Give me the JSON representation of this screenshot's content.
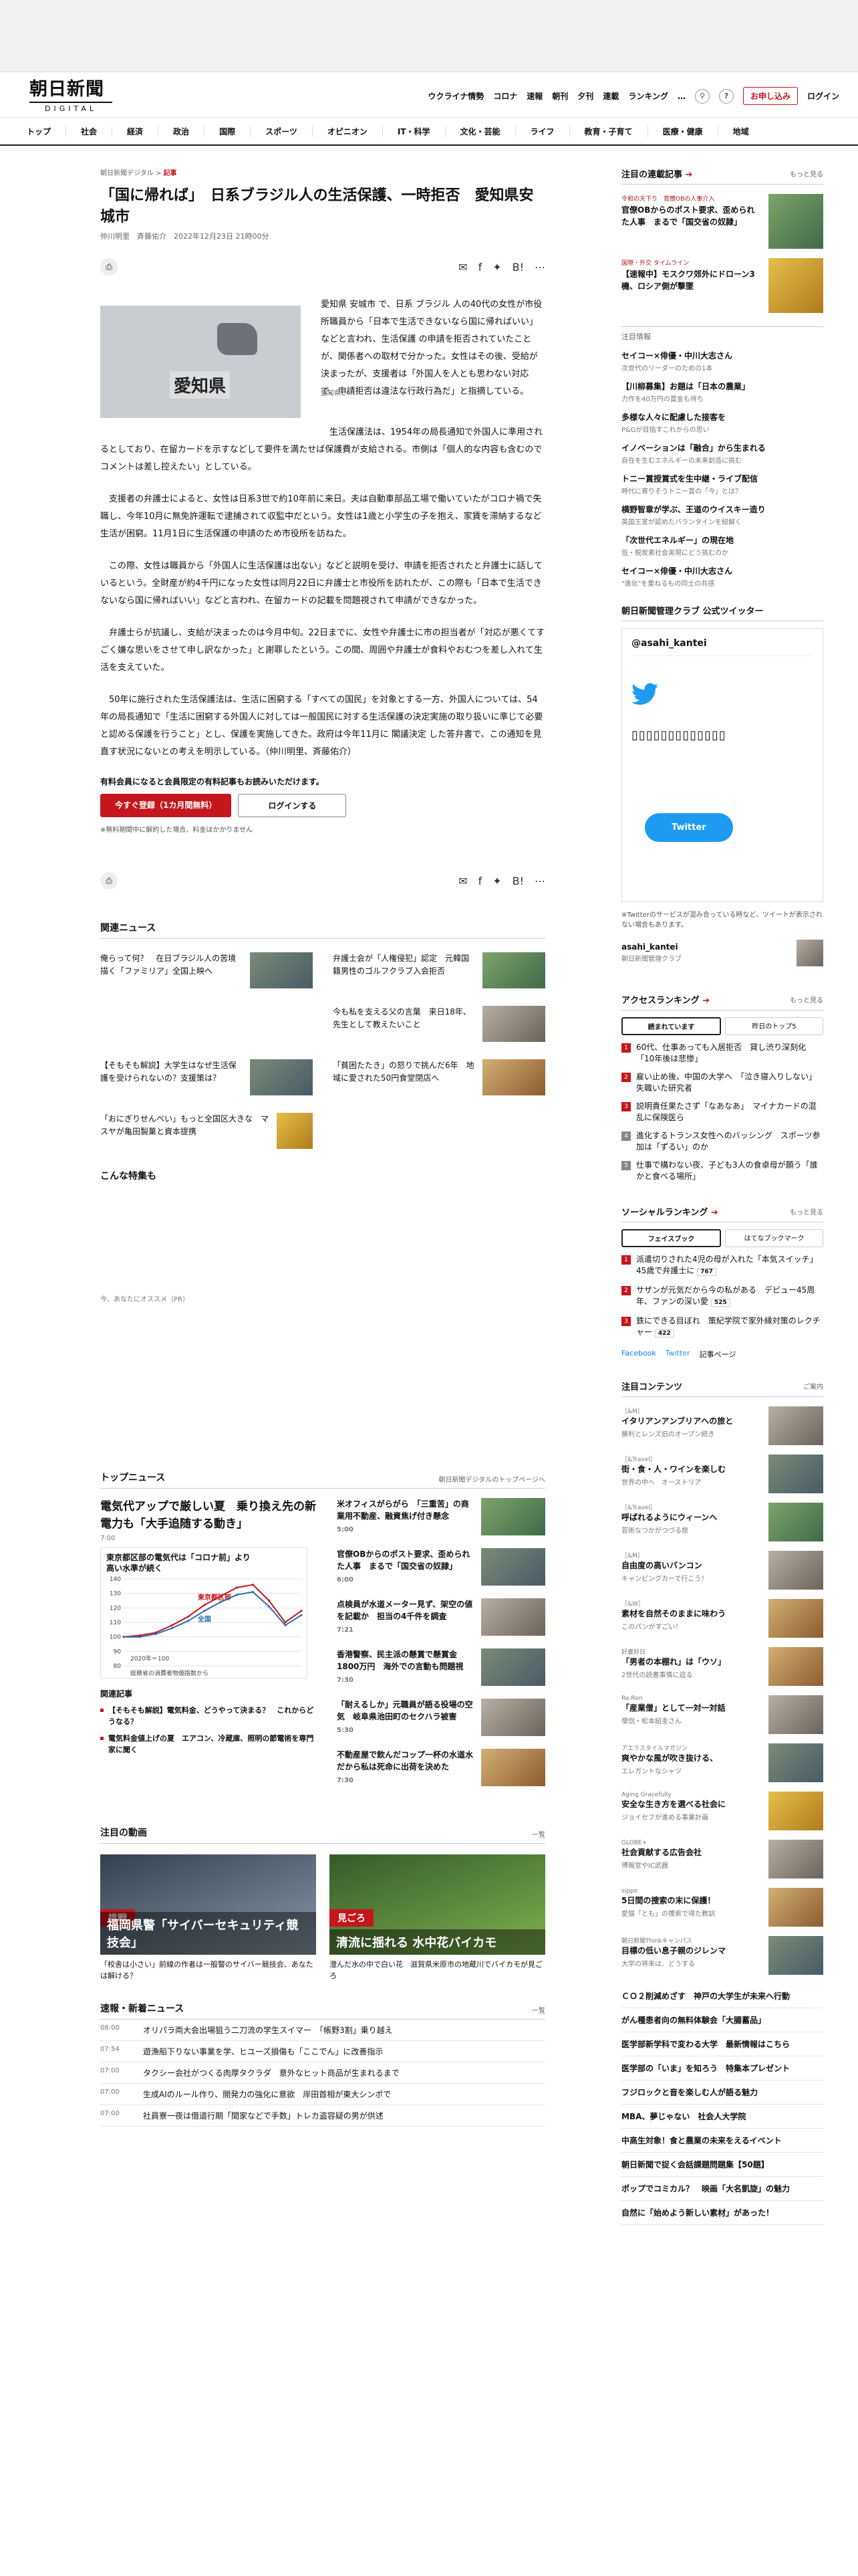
{
  "header": {
    "logo_jp": "朝日新聞",
    "logo_en": "DIGITAL",
    "nav": [
      "ウクライナ情勢",
      "コロナ",
      "速報",
      "朝刊",
      "夕刊",
      "連載",
      "ランキング"
    ],
    "more": "…",
    "signup": "お申し込み",
    "login": "ログイン"
  },
  "gnav": [
    "トップ",
    "社会",
    "経済",
    "政治",
    "国際",
    "スポーツ",
    "オピニオン",
    "IT・科学",
    "文化・芸能",
    "ライフ",
    "教育・子育て",
    "医療・健康",
    "地域"
  ],
  "article": {
    "crumb_home": "朝日新聞デジタル",
    "crumb_current": "記事",
    "title": "「国に帰れば」　日系ブラジル人の生活保護、一時拒否　愛知県安城市",
    "byline": "仲川明里　斉藤佑介　2022年12月23日 21時00分",
    "map_label": "愛知県",
    "map_caption": "愛知県",
    "lead": "愛知県 安城市 で、日系 ブラジル 人の40代の女性が市役所職員から「日本で生活できないなら国に帰ればいい」などと言われ、生活保護 の申請を拒否されていたことが、関係者への取材で分かった。女性はその後、受給が決まったが、支援者は「外国人を人とも思わない対応で、申請拒否は違法な行政行為だ」と指摘している。",
    "paragraphs": [
      "生活保護法は、1954年の局長通知で外国人に準用されるとしており、在留カードを示すなどして要件を満たせば保護費が支給される。市側は「個人的な内容も含むのでコメントは差し控えたい」としている。",
      "支援者の弁護士によると、女性は日系3世で約10年前に来日。夫は自動車部品工場で働いていたがコロナ禍で失職し、今年10月に無免許運転で逮捕されて収監中だという。女性は1歳と小学生の子を抱え、家賃を滞納するなど生活が困窮。11月1日に生活保護の申請のため市役所を訪ねた。",
      "この際、女性は職員から「外国人に生活保護は出ない」などと説明を受け、申請を拒否されたと弁護士に話しているという。全財産が約4千円になった女性は同月22日に弁護士と市役所を訪れたが、この際も「日本で生活できないなら国に帰ればいい」などと言われ、在留カードの記載を問題視されて申請ができなかった。",
      "弁護士らが抗議し、支給が決まったのは今月中旬。22日までに、女性や弁護士に市の担当者が「対応が悪くてすごく嫌な思いをさせて申し訳なかった」と謝罪したという。この間、周囲や弁護士が食料やおむつを差し入れて生活を支えていた。",
      "50年に施行された生活保護法は、生活に困窮する「すべての国民」を対象とする一方、外国人については、54年の局長通知で「生活に困窮する外国人に対しては一般国民に対する生活保護の決定実施の取り扱いに準じて必要と認める保護を行うこと」とし、保護を実施してきた。政府は今年11月に 閣議決定 した答弁書で、この通知を見直す状況にないとの考えを明示している。（仲川明里、斉藤佑介）"
    ],
    "share_count1": "list",
    "share_count2": "0"
  },
  "cta": {
    "title": "有料会員になると会員限定の有料記事もお読みいただけます。",
    "primary": "今すぐ登録（1カ月間無料）",
    "secondary": "ログインする",
    "note": "※無料期間中に解約した場合、料金はかかりません"
  },
  "related": {
    "heading": "関連ニュース",
    "items": [
      "俺らって何？　在日ブラジル人の苦境描く「ファミリア」全国上映へ",
      "弁護士会が「人権侵犯」認定　元韓国籍男性のゴルフクラブ入会拒否",
      "",
      "今も私を支える父の言葉　来日18年、先生として教えたいこと",
      "【そもそも解説】大学生はなぜ生活保護を受けられないの？支援策は？",
      "「貧困たたき」の怒りで挑んだ6年　地域に愛された50円食堂閉店へ",
      "「おにぎりせんべい」もっと全国区大きな　マスヤが亀田製菓と資本提携",
      ""
    ]
  },
  "feature": {
    "heading": "こんな特集も",
    "pr": "今、あなたにオススメ（PR）"
  },
  "topnews": {
    "heading": "トップニュース",
    "link": "朝日新聞デジタルのトップページへ",
    "main_title": "電気代アップで厳しい夏　乗り換え先の新電力も「大手追随する動き」",
    "main_time": "7:00",
    "chart_title": "東京都区部の電気代は「コロナ前」より高い水準が続く",
    "related_heading": "関連記事",
    "related": [
      "【そもそも解説】電気料金、どうやって決まる？　これからどうなる？",
      "電気料金値上げの夏　エアコン、冷蔵庫、照明の節電術を専門家に聞く"
    ],
    "items": [
      {
        "title": "米オフィスがらがら　「三重苦」の商業用不動産、融資焦げ付き懸念",
        "time": "5:00"
      },
      {
        "title": "官僚OBからのポスト要求、歪められた人事　まるで「国交省の奴隷」",
        "time": "6:00"
      },
      {
        "title": "点検員が水道メーター見ず、架空の値を記載か　担当の4千件を調査",
        "time": "7:21"
      },
      {
        "title": "香港警察、民主派の懸賞で懸賞金1800万円　海外での言動も問題視",
        "time": "7:30"
      },
      {
        "title": "「耐えるしか」元職員が語る役場の空気　岐阜県池田町のセクハラ被害",
        "time": "5:30"
      },
      {
        "title": "不動産屋で飲んだコップ一杯の水道水　だから私は死命に出荷を決めた",
        "time": "7:30"
      }
    ]
  },
  "chart_data": {
    "type": "line",
    "title": "東京都区部の電気代は「コロナ前」より高い水準が続く",
    "annotation": "2020年＝100",
    "series": [
      {
        "name": "東京都区部",
        "values": [
          100,
          101,
          103,
          108,
          114,
          122,
          128,
          134,
          136,
          125,
          110,
          118
        ]
      },
      {
        "name": "全国",
        "values": [
          100,
          100,
          102,
          106,
          111,
          118,
          124,
          129,
          131,
          121,
          108,
          115
        ]
      }
    ],
    "ylim": [
      80,
      140
    ],
    "yticks": [
      80,
      90,
      100,
      110,
      120,
      130,
      140
    ],
    "note": "総務省の消費者物価指数から"
  },
  "videos": {
    "heading": "注目の動画",
    "more": "一覧",
    "items": [
      {
        "tag": "挑戦",
        "overlay": "福岡県警「サイバーセキュリティ競技会」",
        "caption": "「校舎は小さい」前線の作者は一般警のサイバー競技会、あなたは解ける？"
      },
      {
        "tag": "見ごろ",
        "overlay": "清流に揺れる 水中花バイカモ",
        "caption": "澄んだ水の中で白い花　滋賀県米原市の地蔵川でバイカモが見ごろ"
      }
    ]
  },
  "breaking": {
    "heading": "速報・新着ニュース",
    "more": "一覧",
    "items": [
      {
        "time": "08:00",
        "text": "オリパラ両大会出場狙う二刀流の学生スイマー　「帳野3割」乗り越え"
      },
      {
        "time": "07:54",
        "text": "遊漁船下りない事業を学、ヒユーズ損傷も「ここでん」に改善指示"
      },
      {
        "time": "07:00",
        "text": "タクシー会社がつくる肉厚タクラダ　意外なヒット商品が生まれるまで"
      },
      {
        "time": "07:00",
        "text": "生成AIのルール作り、開発力の強化に意欲　岸田首相が東大シンポで"
      },
      {
        "time": "07:00",
        "text": "社員寮一夜は借道行期「間家などで手数」トレカ盗容疑の男が供述"
      }
    ]
  },
  "sidebar": {
    "series_heading": "注目の連載記事",
    "series_more": "もっと見る",
    "series_items": [
      {
        "sub": "令和の天下り　官僚OBの人事介入",
        "title": "官僚OBからのポスト要求、歪められた人事　まるで「国交省の奴隷」"
      },
      {
        "sub": "国際・外交 タイムライン",
        "title": "【速報中】モスクワ郊外にドローン3機、ロシア側が撃墜"
      }
    ],
    "pr_heading": "注目情報",
    "pr_items": [
      {
        "title": "セイコー×俳優・中川大志さん",
        "sub": "次世代のリーダーのための1本"
      },
      {
        "title": "【川柳募集】お題は「日本の農業」",
        "sub": "力作を40万円の賞金も待ち"
      },
      {
        "title": "多様な人々に配慮した接客を",
        "sub": "P&Gが目指すこれからの思い"
      },
      {
        "title": "イノベーションは「融合」から生まれる",
        "sub": "自在を生むエネルギーの未来創造に挑む"
      },
      {
        "title": "トニー賞授賞式を生中継・ライブ配信",
        "sub": "時代に寄りそうトニー賞の「今」とは？"
      },
      {
        "title": "横野智章が学ぶ、王道のウイスキー造り",
        "sub": "英国王室が認めたバランタインを紐解く"
      },
      {
        "title": "「次世代エネルギー」の現在地",
        "sub": "低・脱炭素社会実現にどう挑むのか"
      },
      {
        "title": "セイコー×俳優・中川大志さん",
        "sub": "\"進化\"を重ねるもの同士の共感"
      }
    ],
    "twitter_heading": "朝日新聞管理クラブ 公式ツイッター",
    "twitter_handle": "@asahi_kantei",
    "twitter_btn": "Twitter",
    "twitter_note": "※Twitterのサービスが混み合っている時など、ツイートが表示されない場合もあります。",
    "twitter_acct": "asahi_kantei",
    "twitter_acct_sub": "朝日新聞管理クラブ",
    "ranking_heading": "アクセスランキング",
    "ranking_more": "もっと見る",
    "ranking_tabs": [
      "読まれています",
      "昨日のトップ5"
    ],
    "ranking": [
      "60代、仕事あっても入居拒否　貸し渋り深刻化「10年後は悲惨」",
      "雇い止め後、中国の大学へ　「泣き寝入りしない」失職いた研究者",
      "説明責任果たさず「なあなあ」　マイナカードの混乱に保険医ら",
      "進化するトランス女性へのバッシング　スポーツ参加は「ずるい」のか",
      "仕事で構わない夜、子ども3人の食卓母が願う「誰かと食べる場所」"
    ],
    "social_heading": "ソーシャルランキング",
    "social_more": "もっと見る",
    "social_tabs": [
      "フェイスブック",
      "はてなブックマーク"
    ],
    "social": [
      {
        "text": "派遣切りされた4児の母が入れた「本気スイッチ」　45歳で弁護士に",
        "count": "767"
      },
      {
        "text": "サザンが元気だから今の私がある　デビュー45周年、ファンの深い愛",
        "count": "525"
      },
      {
        "text": "鉄にできる目ぼれ　策紀学院で家外縁対策のレクチャー",
        "count": "422"
      }
    ],
    "social_links": [
      "Facebook",
      "Twitter",
      "記事ページ"
    ],
    "content_heading": "注目コンテンツ",
    "content_more": "ご案内",
    "contents": [
      {
        "src": "［&M］",
        "title": "イタリアンアンブリアへの旅と",
        "sub": "勝利とレンズ旧のオープン続き"
      },
      {
        "src": "［&Travel］",
        "title": "街・食・人・ワインを楽しむ",
        "sub": "世界の中へ　オーストリア"
      },
      {
        "src": "［&Travel］",
        "title": "呼ばれるようにウィーンへ",
        "sub": "芸術なつかがつづる旅"
      },
      {
        "src": "［&M］",
        "title": "自由度の高いバンコン",
        "sub": "キャンピングカーで行こう！"
      },
      {
        "src": "［&W］",
        "title": "素材を自然そのままに味わう",
        "sub": "このパンがすごい！"
      },
      {
        "src": "好書好日",
        "title": "「男者の本棚れ」は「ウソ」",
        "sub": "2世代の読書事情に迫る"
      },
      {
        "src": "Re:Ron",
        "title": "「産業僧」として一対一対話",
        "sub": "僧侶・松本紹圭さん"
      },
      {
        "src": "アエラスタイルマガジン",
        "title": "爽やかな風が吹き抜ける、",
        "sub": "エレガントなシャツ"
      },
      {
        "src": "Aging Gracefully",
        "title": "安全な生き方を選べる社会に",
        "sub": "ジョイセフが進める事業計画"
      },
      {
        "src": "GLOBE+",
        "title": "社会貢献する広告会社",
        "sub": "博報堂やIC武器"
      },
      {
        "src": "sippo",
        "title": "5日間の捜索の末に保護！",
        "sub": "愛猫「とも」の捜索で得た教訓"
      },
      {
        "src": "朝日新聞Thinkキャンパス",
        "title": "目標の低い息子親のジレンマ",
        "sub": "大学の将来は、どうする"
      }
    ],
    "text_list": [
      "ＣＯ２削減めざす　神戸の大学生が未来へ行動",
      "がん種患者向の無料体験会「大腸蓄品」",
      "医学部新学科で変わる大学　最新情報はこちら",
      "医学部の「いま」を知ろう　特集本プレゼント",
      "フジロックと音を楽しむ人が語る魅力",
      "MBA、夢じゃない　社会人大学院",
      "中高生対象！食と農業の未来をえるイベント",
      "朝日新聞で捉く会話課題問題集【50題】",
      "ポップでコミカル？　映画「大名凱旋」の魅力",
      "自然に「始めよう新しい素材」があった！"
    ]
  }
}
